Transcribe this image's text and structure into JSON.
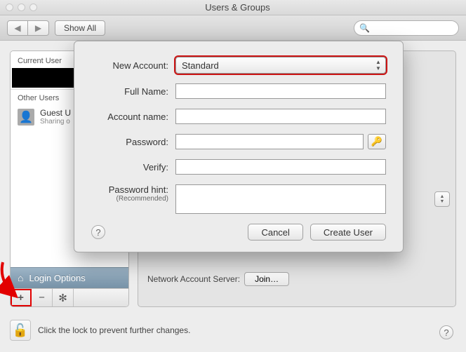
{
  "window": {
    "title": "Users & Groups"
  },
  "toolbar": {
    "back": "◀",
    "forward": "▶",
    "show_all": "Show All",
    "search_placeholder": ""
  },
  "sidebar": {
    "current_label": "Current User",
    "other_label": "Other Users",
    "guest": {
      "name": "Guest U",
      "sub": "Sharing o"
    },
    "login_options": "Login Options",
    "buttons": {
      "plus": "+",
      "minus": "−",
      "gear": "✻"
    }
  },
  "content": {
    "network_label": "Network Account Server:",
    "join": "Join…"
  },
  "footer": {
    "lock_text": "Click the lock to prevent further changes."
  },
  "sheet": {
    "labels": {
      "new_account": "New Account:",
      "full_name": "Full Name:",
      "account_name": "Account name:",
      "password": "Password:",
      "verify": "Verify:",
      "hint": "Password hint:",
      "recommended": "(Recommended)"
    },
    "account_type": "Standard",
    "values": {
      "full_name": "",
      "account_name": "",
      "password": "",
      "verify": "",
      "hint": ""
    },
    "buttons": {
      "cancel": "Cancel",
      "create": "Create User"
    }
  }
}
